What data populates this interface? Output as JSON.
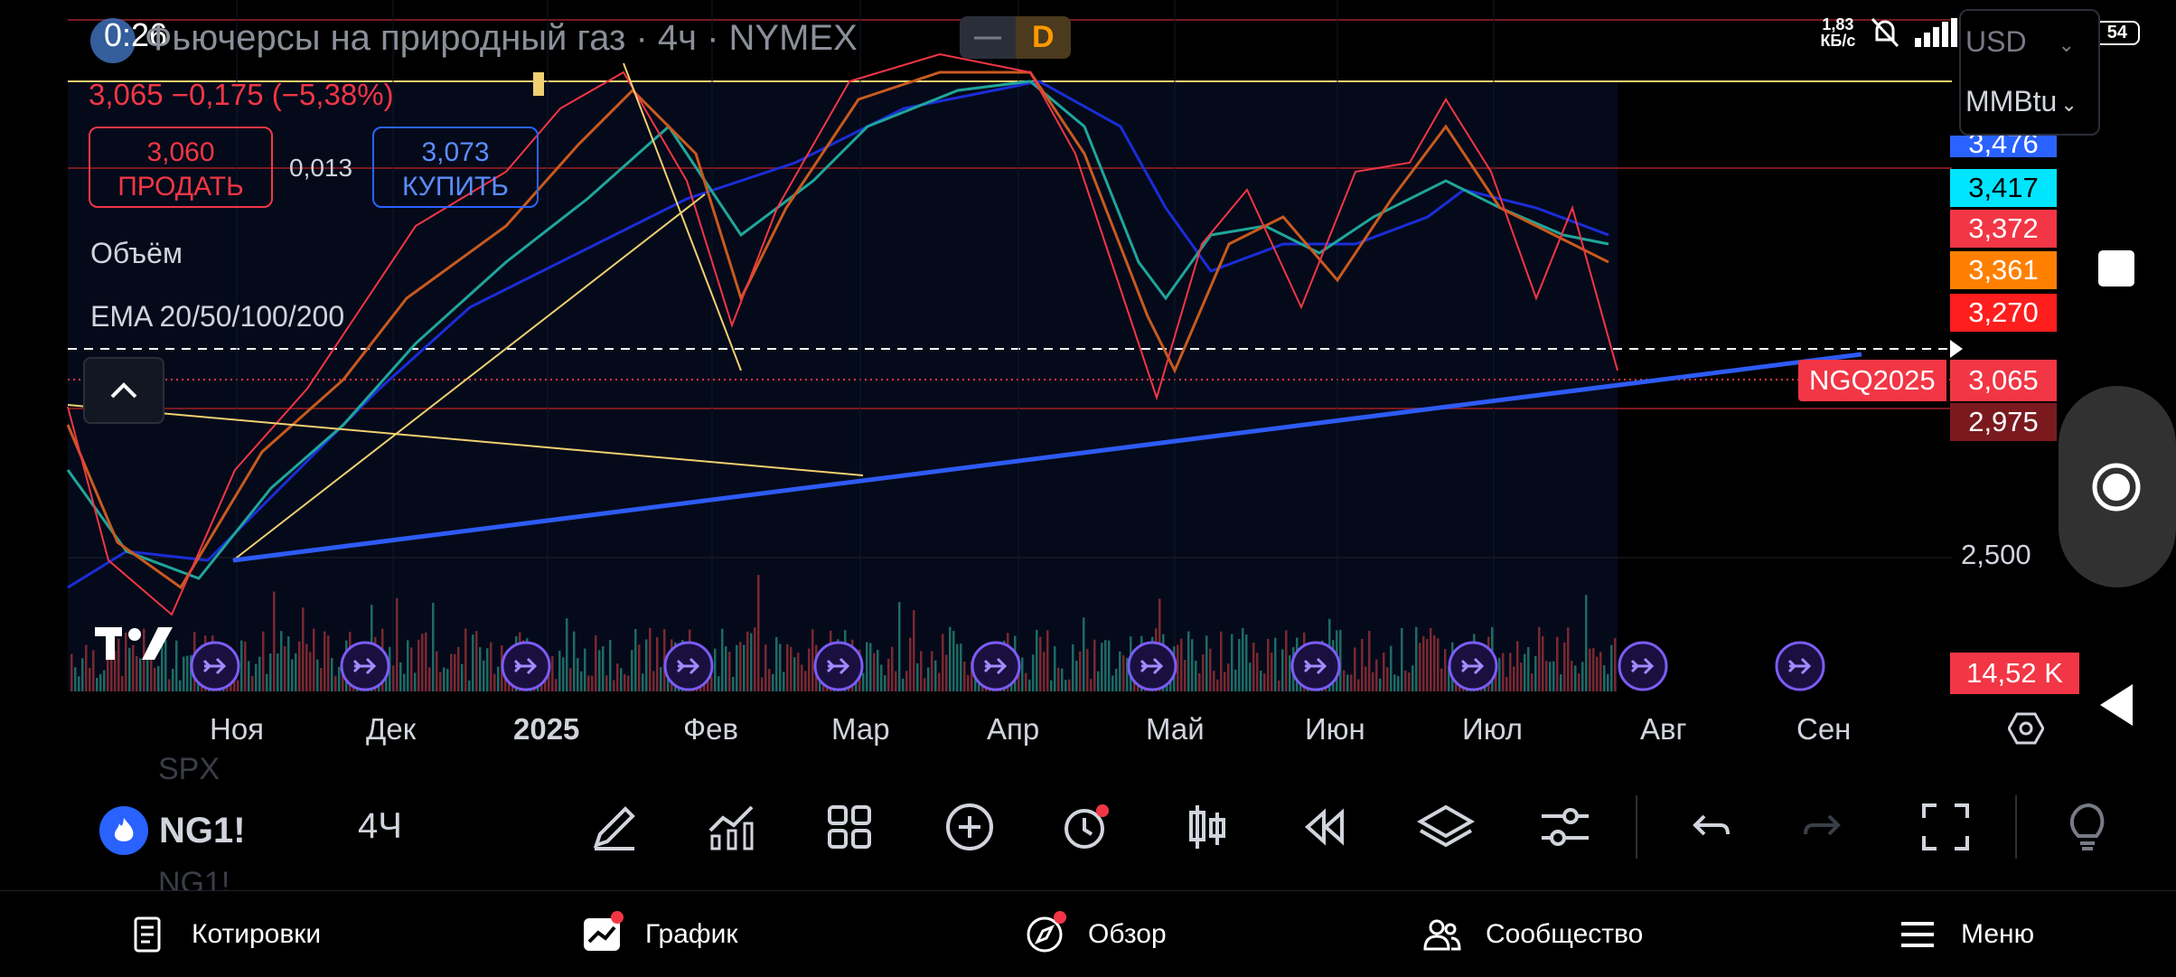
{
  "status_bar": {
    "time": "0:26",
    "net_speed_top": "1,83",
    "net_speed_bottom": "КБ/с",
    "network": "4G",
    "battery": "54"
  },
  "header": {
    "title": "Фьючерсы на природный газ · 4ч · NYMEX",
    "badge_gray": "—",
    "badge_d": "D",
    "price_change": "3,065  −0,175 (−5,38%)",
    "currency": "USD",
    "unit": "MMBtu"
  },
  "trade": {
    "sell_price": "3,060",
    "sell_label": "ПРОДАТЬ",
    "spread": "0,013",
    "buy_price": "3,073",
    "buy_label": "КУПИТЬ"
  },
  "indicators": {
    "volume": "Объём",
    "ema": "EMA 20/50/100/200"
  },
  "price_scale": {
    "p1": "3,476",
    "p2": "3,417",
    "p3": "3,372",
    "p4": "3,361",
    "p5": "3,270",
    "p6": "3,065",
    "p7": "2,975",
    "p8": "2,500",
    "symbol_tag": "NGQ2025",
    "volume_tag": "14,52 K",
    "colors": {
      "p1": "#2962ff",
      "p2": "#00e5ff",
      "p3": "#f23645",
      "p4": "#ff8000",
      "p5": "#ff1e1e",
      "p6": "#f23645",
      "p7": "#7a1a1f"
    }
  },
  "time_axis": [
    "Ноя",
    "Дек",
    "2025",
    "Фев",
    "Мар",
    "Апр",
    "Май",
    "Июн",
    "Июл",
    "Авг",
    "Сен"
  ],
  "toolbar": {
    "symbol": "NG1!",
    "timeframe": "4Ч",
    "ghost_top": "SPX",
    "ghost_bottom": "NG1!"
  },
  "bottom_nav": {
    "quotes": "Котировки",
    "chart": "График",
    "overview": "Обзор",
    "community": "Сообщество",
    "menu": "Меню"
  },
  "logo": "TV"
}
